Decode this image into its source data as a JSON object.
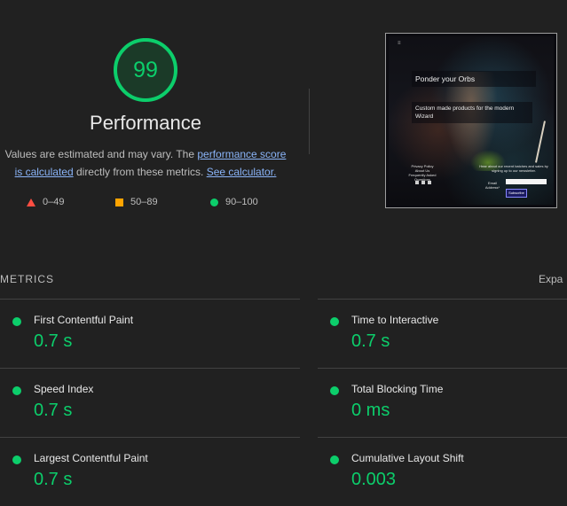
{
  "performance": {
    "score": "99",
    "score_value": 99,
    "title": "Performance",
    "description_prefix": "Values are estimated and may vary. The ",
    "score_link": "performance score",
    "score_link_2": "is calculated",
    "description_middle": " directly from these metrics. ",
    "calculator_link": "See calculator.",
    "accent_color": "#0cce6b"
  },
  "legend": [
    {
      "icon": "triangle-icon",
      "label": "0–49",
      "color": "#ff4e42"
    },
    {
      "icon": "square-icon",
      "label": "50–89",
      "color": "#ffa400"
    },
    {
      "icon": "circle-icon",
      "label": "90–100",
      "color": "#0cce6b"
    }
  ],
  "screenshot": {
    "hero_title": "Ponder your Orbs",
    "hero_subtitle": "Custom made products for the modern Wizard",
    "footer_links": [
      "Privacy Policy",
      "About Us",
      "Frequently Asked Questions"
    ],
    "newsletter_text": "Hear about our recent batches and sales by signing up to our newsletter.",
    "email_label": "Email Address*",
    "subscribe_label": "Subscribe"
  },
  "metrics": {
    "header": "METRICS",
    "expand": "Expa",
    "items": [
      {
        "name": "First Contentful Paint",
        "value": "0.7 s"
      },
      {
        "name": "Time to Interactive",
        "value": "0.7 s"
      },
      {
        "name": "Speed Index",
        "value": "0.7 s"
      },
      {
        "name": "Total Blocking Time",
        "value": "0 ms"
      },
      {
        "name": "Largest Contentful Paint",
        "value": "0.7 s"
      },
      {
        "name": "Cumulative Layout Shift",
        "value": "0.003"
      }
    ]
  }
}
